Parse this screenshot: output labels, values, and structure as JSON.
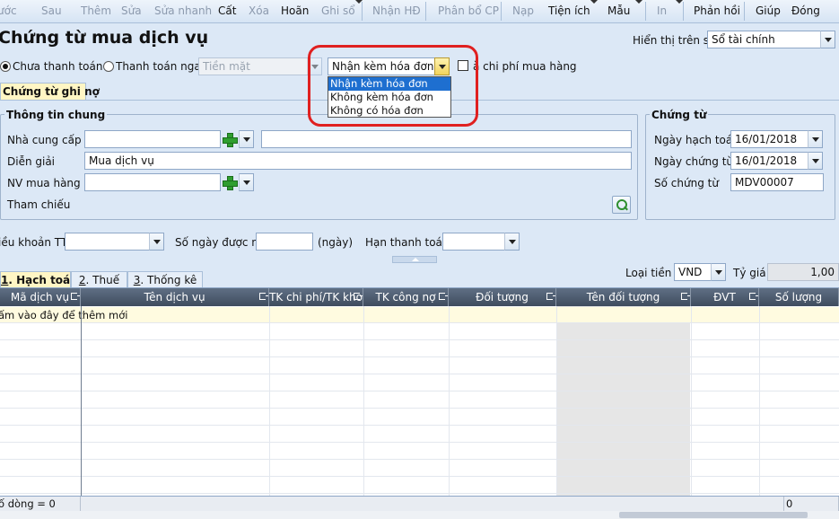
{
  "toolbar": {
    "items": [
      "ước",
      "Sau",
      "Thêm",
      "Sửa",
      "Sửa nhanh",
      "Cất",
      "Xóa",
      "Hoãn",
      "Ghi sổ",
      "Nhận HĐ",
      "Phân bổ CP",
      "Nạp",
      "Tiện ích",
      "Mẫu",
      "In",
      "Phản hồi",
      "Giúp",
      "Đóng"
    ]
  },
  "header": {
    "title": "Chứng từ mua dịch vụ",
    "display_label": "Hiển thị trên sổ",
    "display_value": "Sổ tài chính"
  },
  "payment": {
    "unpaid": "Chưa thanh toán",
    "paid_now": "Thanh toán ngay",
    "method": "Tiền mặt",
    "invoice_value": "Nhận kèm hóa đơn",
    "invoice_options": [
      "Nhận kèm hóa đơn",
      "Không kèm hóa đơn",
      "Không có hóa đơn"
    ],
    "cost_checkbox": "à chi phí mua hàng"
  },
  "tab_top": "Chứng từ ghi nợ",
  "general": {
    "title": "Thông tin chung",
    "supplier_label": "Nhà cung cấp",
    "supplier_value": "",
    "supplier_name": "",
    "desc_label": "Diễn giải",
    "desc_value": "Mua dịch vụ",
    "staff_label": "NV mua hàng",
    "staff_value": "",
    "ref_label": "Tham chiếu"
  },
  "voucher": {
    "title": "Chứng từ",
    "posting_date_label": "Ngày hạch toán",
    "posting_date": "16/01/2018",
    "voucher_date_label": "Ngày chứng từ",
    "voucher_date": "16/01/2018",
    "voucher_no_label": "Số chứng từ",
    "voucher_no": "MDV00007"
  },
  "terms": {
    "terms_label": "iều khoản TT",
    "days_label": "Số ngày được nợ",
    "days_unit": "(ngày)",
    "due_label": "Hạn thanh toán"
  },
  "bottom_tabs": {
    "t1_num": "1",
    "t1_text": ". Hạch toán",
    "t2_num": "2",
    "t2_text": ". Thuế",
    "t3_num": "3",
    "t3_text": ". Thống kê"
  },
  "currency": {
    "label": "Loại tiền",
    "value": "VND",
    "rate_label": "Tỷ giá",
    "rate_value": "1,00"
  },
  "grid": {
    "columns": [
      "Mã dịch vụ",
      "Tên dịch vụ",
      "TK chi phí/TK kho",
      "TK công nợ",
      "Đối tượng",
      "Tên đối tượng",
      "ĐVT",
      "Số lượng"
    ],
    "new_row_hint": "ấm vào đây để thêm mới",
    "row_count": "ố dòng = 0",
    "footer_total": "0"
  },
  "colors": {
    "selected": "#1e6fd0",
    "highlight": "#e02020",
    "tab_active": "#fff6c4",
    "header_bg": "#4c5a6c"
  }
}
